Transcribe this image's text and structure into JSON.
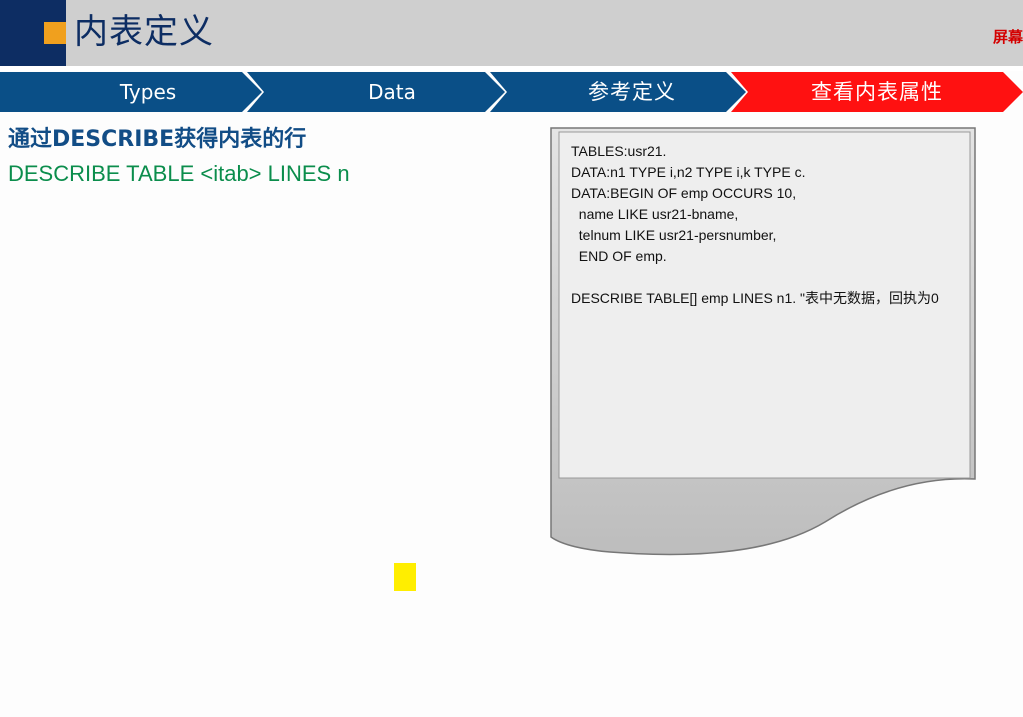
{
  "header": {
    "title": "内表定义",
    "right_text": "屏幕"
  },
  "tabs": [
    {
      "label": "Types",
      "color": "#0a4f87"
    },
    {
      "label": "Data",
      "color": "#0a4f87"
    },
    {
      "label": "参考定义",
      "color": "#0a4f87"
    },
    {
      "label": "查看内表属性",
      "color": "#ff1111"
    }
  ],
  "content": {
    "title": "通过DESCRIBE获得内表的行",
    "syntax": "DESCRIBE TABLE <itab> LINES n"
  },
  "code": {
    "lines": [
      "TABLES:usr21.",
      "DATA:n1 TYPE i,n2 TYPE i,k TYPE c.",
      "DATA:BEGIN OF emp OCCURS 10,",
      "  name LIKE usr21-bname,",
      "  telnum LIKE usr21-persnumber,",
      "  END OF emp.",
      ""
    ],
    "last_line": "DESCRIBE TABLE[] emp LINES n1.    \"表中无数据，回执为0"
  },
  "colors": {
    "navy": "#0d2d63",
    "orange": "#f0a01e",
    "tab_blue": "#0a4f87",
    "tab_red": "#ff1111",
    "title_blue": "#124d86",
    "syntax_green": "#0b8d4c",
    "marker_yellow": "#ffee00"
  }
}
